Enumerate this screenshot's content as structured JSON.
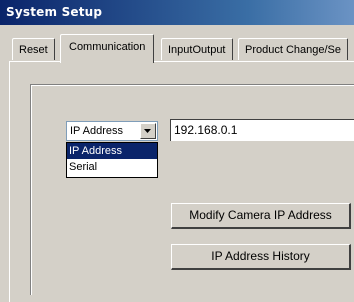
{
  "window": {
    "title": "System Setup"
  },
  "tabs": [
    {
      "label": "Reset"
    },
    {
      "label": "Communication"
    },
    {
      "label": "InputOutput"
    },
    {
      "label": "Product Change/Se"
    }
  ],
  "connection": {
    "type_selected": "IP Address",
    "options": [
      "IP Address",
      "Serial"
    ],
    "ip_value": "192.168.0.1"
  },
  "buttons": {
    "modify_label": "Modify  Camera IP Address",
    "history_label": "IP Address History"
  }
}
